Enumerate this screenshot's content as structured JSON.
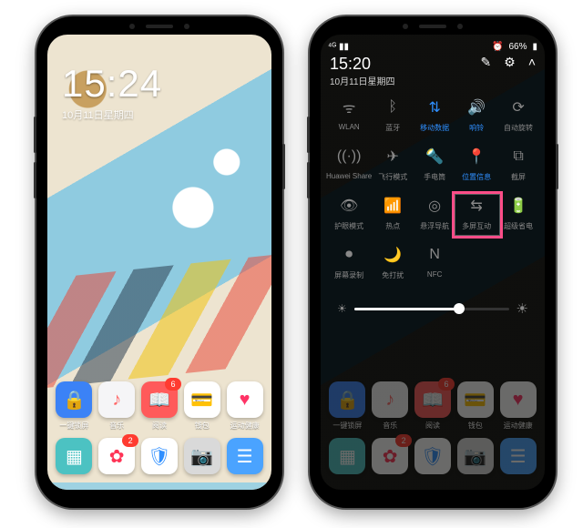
{
  "left": {
    "clock_time": "15:24",
    "clock_date": "10月11日星期四",
    "apps_row1": [
      {
        "label": "一键锁屏",
        "glyph": "🔒",
        "bg": "#3b82f6",
        "badge": ""
      },
      {
        "label": "音乐",
        "glyph": "♪",
        "bg": "#f5f5f7",
        "fg": "#ff6b6b",
        "badge": ""
      },
      {
        "label": "阅读",
        "glyph": "📖",
        "bg": "#ff5a5a",
        "badge": "6"
      },
      {
        "label": "钱包",
        "glyph": "💳",
        "bg": "#ffffff",
        "fg": "#333",
        "badge": ""
      },
      {
        "label": "运动健康",
        "glyph": "♥",
        "bg": "#ffffff",
        "fg": "#ff3366",
        "badge": ""
      }
    ],
    "apps_row2": [
      {
        "label": "",
        "glyph": "▦",
        "bg": "#4cc2c2",
        "badge": ""
      },
      {
        "label": "",
        "glyph": "✿",
        "bg": "#ffffff",
        "fg": "#ff3355",
        "badge": "2"
      },
      {
        "label": "",
        "glyph": "🛡",
        "bg": "#ffffff",
        "fg": "#2f8fff",
        "badge": ""
      },
      {
        "label": "",
        "glyph": "📷",
        "bg": "#d9d9d9",
        "fg": "#333",
        "badge": ""
      },
      {
        "label": "",
        "glyph": "☰",
        "bg": "#4aa3ff",
        "badge": ""
      }
    ]
  },
  "right": {
    "status_left": "⁴ᴳ ▮▮",
    "battery_text": "66%",
    "panel_time": "15:20",
    "panel_date": "10月11日星期四",
    "tools": {
      "edit": "✎",
      "settings": "⚙",
      "collapse": "˄"
    },
    "toggles": [
      {
        "label": "WLAN",
        "glyph": "ᯤ",
        "on": false
      },
      {
        "label": "蓝牙",
        "glyph": "ᛒ",
        "on": false
      },
      {
        "label": "移动数据",
        "glyph": "⇅",
        "on": true
      },
      {
        "label": "响铃",
        "glyph": "🔊",
        "on": true
      },
      {
        "label": "自动旋转",
        "glyph": "⟳",
        "on": false
      },
      {
        "label": "Huawei Share",
        "glyph": "((·))",
        "on": false
      },
      {
        "label": "飞行模式",
        "glyph": "✈",
        "on": false
      },
      {
        "label": "手电筒",
        "glyph": "🔦",
        "on": false
      },
      {
        "label": "位置信息",
        "glyph": "📍",
        "on": true
      },
      {
        "label": "截屏",
        "glyph": "⧉",
        "on": false
      },
      {
        "label": "护眼模式",
        "glyph": "👁",
        "on": false
      },
      {
        "label": "热点",
        "glyph": "📶",
        "on": false
      },
      {
        "label": "悬浮导航",
        "glyph": "◎",
        "on": false
      },
      {
        "label": "多屏互动",
        "glyph": "⇆",
        "on": false
      },
      {
        "label": "超级省电",
        "glyph": "🔋",
        "on": false
      },
      {
        "label": "屏幕录制",
        "glyph": "⏺",
        "on": false
      },
      {
        "label": "免打扰",
        "glyph": "🌙",
        "on": false
      },
      {
        "label": "NFC",
        "glyph": "N",
        "on": false
      }
    ],
    "brightness_pct": 68,
    "highlight_index": 13
  }
}
